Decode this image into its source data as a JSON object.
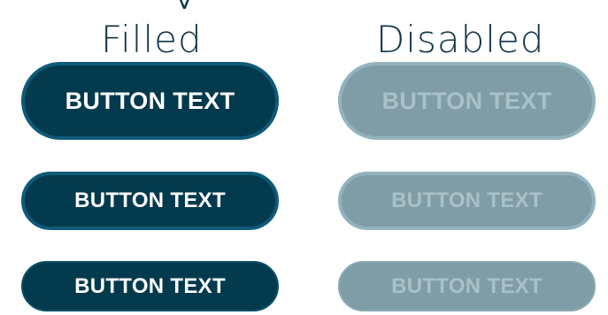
{
  "header": {
    "cut_glyph": "y"
  },
  "columns": {
    "filled": {
      "title": "Filled",
      "buttons": [
        {
          "size": "large",
          "label": "BUTTON TEXT"
        },
        {
          "size": "medium",
          "label": "BUTTON TEXT"
        },
        {
          "size": "small",
          "label": "BUTTON TEXT"
        }
      ]
    },
    "disabled": {
      "title": "Disabled",
      "buttons": [
        {
          "size": "large",
          "label": "BUTTON TEXT"
        },
        {
          "size": "medium",
          "label": "BUTTON TEXT"
        },
        {
          "size": "small",
          "label": "BUTTON TEXT"
        }
      ]
    }
  },
  "colors": {
    "filled_background": "#043a4d",
    "filled_border": "#0e5a78",
    "filled_text": "#ffffff",
    "disabled_background": "#7f9da6",
    "disabled_border": "#92b3bd",
    "disabled_text": "#a8c1c8",
    "title_text": "#123448",
    "page_background": "#ffffff"
  }
}
